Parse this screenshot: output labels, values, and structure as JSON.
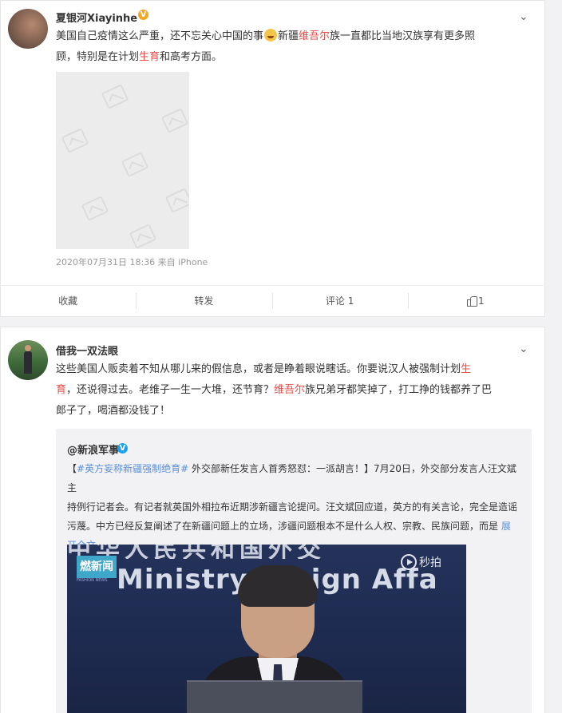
{
  "post1": {
    "author": "夏银河Xiayinhe",
    "verified_badge": "V",
    "text": {
      "l1_a": "美国自己疫情这么严重，还不忘关心中国的事",
      "l1_b": "新疆",
      "l1_hl": "维吾尔",
      "l1_c": "族一直都比当地汉族享有更多照",
      "l2_a": "顾，特别是在计划",
      "l2_hl": "生育",
      "l2_b": "和高考方面。"
    },
    "meta": "2020年07月31日 18:36  来自 iPhone",
    "actions": {
      "collect": "收藏",
      "repost": "转发",
      "comment": "评论 1",
      "like_count": "1"
    }
  },
  "post2": {
    "author": "借我一双法眼",
    "text": {
      "l1_a": "这些美国人贩卖着不知从哪儿来的假信息，或者是睁着眼说瞎话。你要说汉人被强制计划",
      "l1_hl": "生",
      "l2_hl": "育",
      "l2_a": "，还说得过去。老维子一生一大堆，还节育？",
      "l2_hl2": "维吾尔",
      "l2_b": "族兄弟牙都笑掉了，打工挣的钱都养了巴",
      "l3": "郎子了，喝酒都没钱了！"
    },
    "repost": {
      "author": "@新浪军事",
      "verified_badge": "V",
      "topic": "#英方妄称新疆强制绝育#",
      "l1": " 外交部新任发言人首秀怒怼：一派胡言！】7月20日，外交部分发言人汪文斌主",
      "l1_open": "【",
      "l2": "持例行记者会。有记者就英国外相拉布近期涉新疆言论提问。汪文斌回应道，英方的有关言论，完全是造谣",
      "l3": "污蔑。中方已经反复阐述了在新疆问题上的立场，涉疆问题根本不是什么人权、宗教、民族问题，而是",
      "expand_a": "展",
      "expand_b": "开全文",
      "video": {
        "logo": "新闻",
        "logo_prefix": "燃",
        "logo_sub": "FASHION NEWS",
        "brand": "秒拍",
        "banner_cn": "中华人民共和国外交",
        "banner_en": "Ministry  oreign  Affa"
      }
    }
  }
}
